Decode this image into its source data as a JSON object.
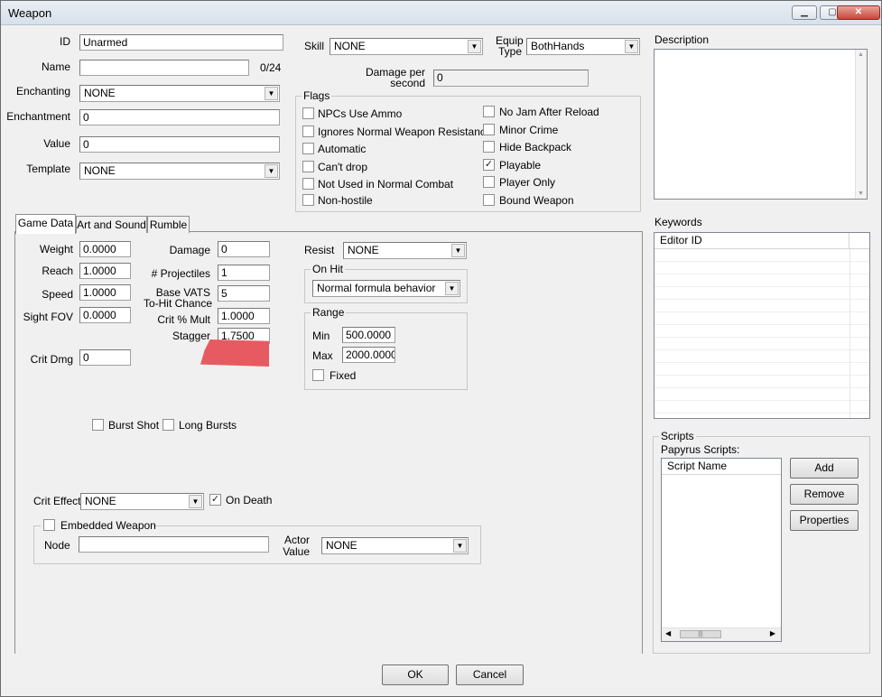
{
  "window": {
    "title": "Weapon",
    "minimize_icon": "minimize-icon",
    "restore_icon": "restore-icon",
    "close_icon": "close-icon"
  },
  "top": {
    "id_label": "ID",
    "id_value": "Unarmed",
    "name_label": "Name",
    "name_value": "",
    "name_count": "0/24",
    "enchanting_label": "Enchanting",
    "enchanting_value": "NONE",
    "enchantment_label": "Enchantment",
    "enchantment_value": "0",
    "value_label": "Value",
    "value_value": "0",
    "template_label": "Template",
    "template_value": "NONE",
    "skill_label": "Skill",
    "skill_value": "NONE",
    "equip_type_label_1": "Equip",
    "equip_type_label_2": "Type",
    "equip_type_value": "BothHands",
    "damage_per_second_label_1": "Damage per",
    "damage_per_second_label_2": "second",
    "damage_per_second_value": "0"
  },
  "flags": {
    "title": "Flags",
    "left": [
      {
        "label": "NPCs Use Ammo",
        "checked": false
      },
      {
        "label": "Ignores Normal Weapon Resistance",
        "checked": false
      },
      {
        "label": "Automatic",
        "checked": false
      },
      {
        "label": "Can't drop",
        "checked": false
      },
      {
        "label": "Not Used in Normal Combat",
        "checked": false
      },
      {
        "label": "Non-hostile",
        "checked": false
      }
    ],
    "right": [
      {
        "label": "No Jam After Reload",
        "checked": false
      },
      {
        "label": "Minor Crime",
        "checked": false
      },
      {
        "label": "Hide Backpack",
        "checked": false
      },
      {
        "label": "Playable",
        "checked": true
      },
      {
        "label": "Player Only",
        "checked": false
      },
      {
        "label": "Bound Weapon",
        "checked": false
      }
    ]
  },
  "description": {
    "label": "Description",
    "value": ""
  },
  "keywords": {
    "label": "Keywords",
    "column": "Editor ID"
  },
  "scripts": {
    "group_label": "Scripts",
    "papyrus_label": "Papyrus Scripts:",
    "column": "Script Name",
    "add": "Add",
    "remove": "Remove",
    "properties": "Properties"
  },
  "tabs": [
    "Game Data",
    "Art and Sound",
    "Rumble"
  ],
  "game_data": {
    "weight_label": "Weight",
    "weight": "0.0000",
    "reach_label": "Reach",
    "reach": "1.0000",
    "speed_label": "Speed",
    "speed": "1.0000",
    "sight_fov_label": "Sight FOV",
    "sight_fov": "0.0000",
    "crit_dmg_label": "Crit Dmg",
    "crit_dmg": "0",
    "damage_label": "Damage",
    "damage": "0",
    "projectiles_label": "# Projectiles",
    "projectiles": "1",
    "vats_label_1": "Base VATS",
    "vats_label_2": "To-Hit Chance",
    "vats": "5",
    "crit_mult_label": "Crit % Mult",
    "crit_mult": "1.0000",
    "stagger_label": "Stagger",
    "stagger": "1.7500",
    "resist_label": "Resist",
    "resist": "NONE",
    "on_hit_title": "On Hit",
    "on_hit": "Normal formula behavior",
    "range_title": "Range",
    "min_label": "Min",
    "min": "500.0000",
    "max_label": "Max",
    "max": "2000.0000",
    "fixed_label": "Fixed",
    "burst_shot_label": "Burst Shot",
    "long_bursts_label": "Long Bursts",
    "crit_effect_label": "Crit Effect",
    "crit_effect": "NONE",
    "on_death_label": "On Death",
    "embedded_label": "Embedded Weapon",
    "node_label": "Node",
    "node": "",
    "actor_value_label_1": "Actor",
    "actor_value_label_2": "Value",
    "actor_value": "NONE"
  },
  "footer": {
    "ok": "OK",
    "cancel": "Cancel"
  }
}
